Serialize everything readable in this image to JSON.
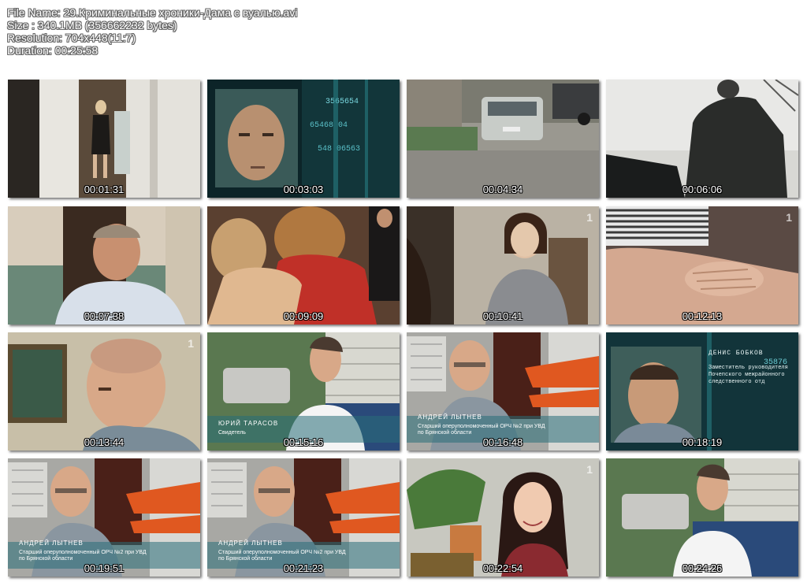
{
  "info": {
    "file_name": "File Name: 29.Криминальные хроники-Дама с вуалью.avi",
    "size": "Size : 340.1MB (356662232 bytes)",
    "resolution": "Resolution: 704x448(11:7)",
    "duration": "Duration: 00:25:58"
  },
  "thumbnails": [
    {
      "time": "00:01:31"
    },
    {
      "time": "00:03:03"
    },
    {
      "time": "00:04:34"
    },
    {
      "time": "00:06:06"
    },
    {
      "time": "00:07:38"
    },
    {
      "time": "00:09:09"
    },
    {
      "time": "00:10:41"
    },
    {
      "time": "00:12:13"
    },
    {
      "time": "00:13:44"
    },
    {
      "time": "00:15:16",
      "caption_name": "ЮРИЙ ТАРАСОВ",
      "caption_position": "Свидетель"
    },
    {
      "time": "00:16:48",
      "caption_name": "АНДРЕЙ ЛЫТНЕВ",
      "caption_position_1": "Старший оперуполномоченный ОРЧ №2 при УВД",
      "caption_position_2": "по Брянской области"
    },
    {
      "time": "00:18:19",
      "caption_name": "ДЕНИС БОБКОВ",
      "caption_position_1": "Заместитель руководителя",
      "caption_position_2": "Почепского межрайонного",
      "caption_position_3": "следственного отд"
    },
    {
      "time": "00:19:51",
      "caption_name": "АНДРЕЙ ЛЫТНЕВ",
      "caption_position_1": "Старший оперуполномоченный ОРЧ №2 при УВД",
      "caption_position_2": "по Брянской области"
    },
    {
      "time": "00:21:23",
      "caption_name": "АНДРЕЙ ЛЫТНЕВ",
      "caption_position_1": "Старший оперуполномоченный ОРЧ №2 при УВД",
      "caption_position_2": "по Брянской области"
    },
    {
      "time": "00:22:54"
    },
    {
      "time": "00:24:26"
    }
  ]
}
